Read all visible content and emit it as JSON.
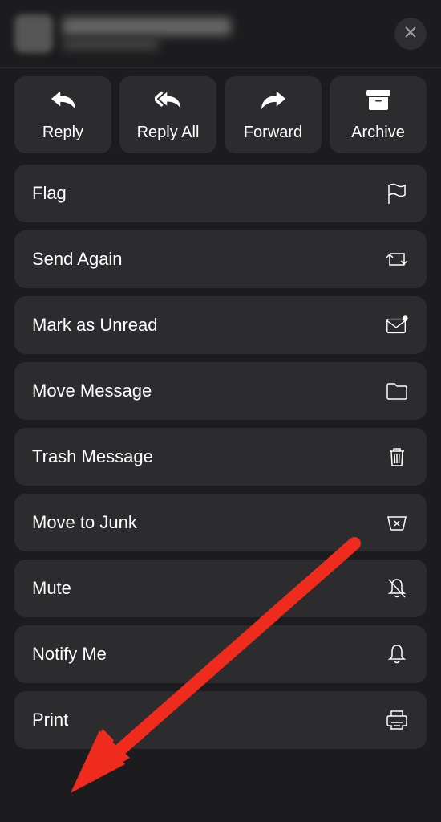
{
  "close_label": "Close",
  "top_actions": {
    "reply": "Reply",
    "reply_all": "Reply All",
    "forward": "Forward",
    "archive": "Archive"
  },
  "menu": {
    "flag": "Flag",
    "send_again": "Send Again",
    "mark_unread": "Mark as Unread",
    "move_message": "Move Message",
    "trash_message": "Trash Message",
    "move_junk": "Move to Junk",
    "mute": "Mute",
    "notify_me": "Notify Me",
    "print": "Print"
  },
  "annotation": {
    "arrow_color": "#ef2b1d"
  }
}
